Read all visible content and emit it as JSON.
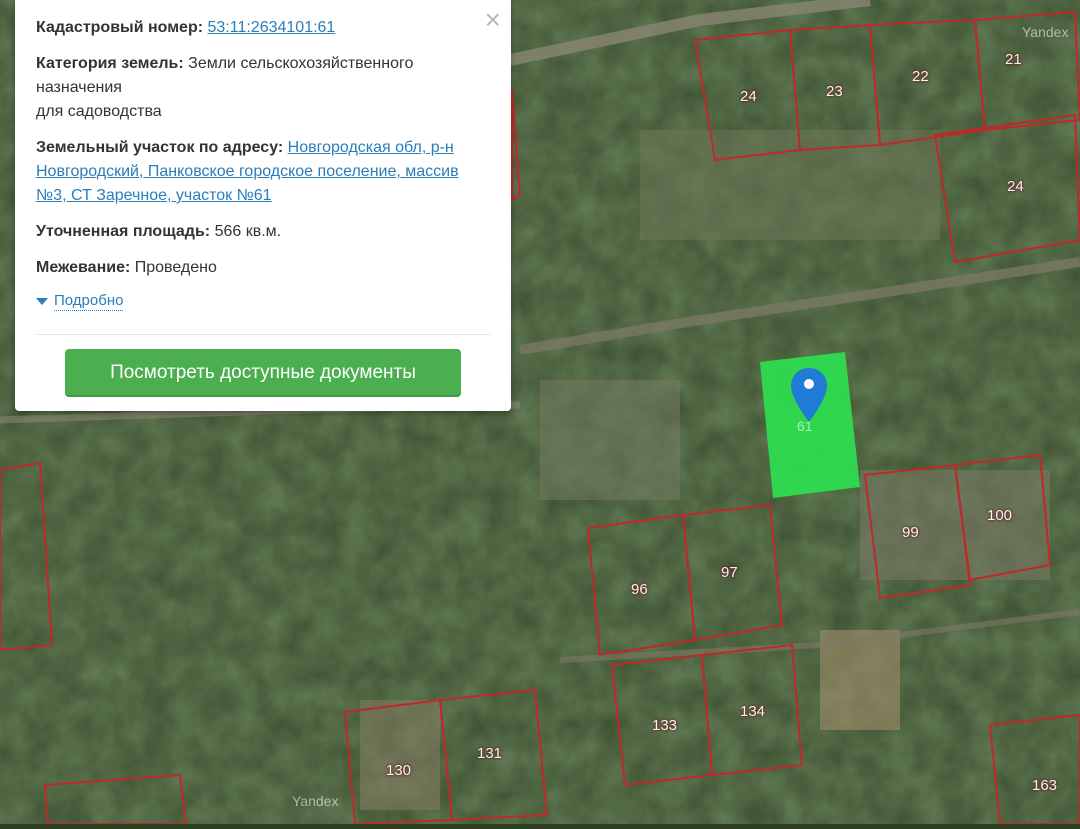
{
  "card": {
    "cadastral_label": "Кадастровый номер:",
    "cadastral_value": "53:11:2634101:61",
    "category_label": "Категория земель:",
    "category_value": "Земли сельскохозяйственного назначения",
    "category_use": "для садоводства",
    "address_label": "Земельный участок по адресу:",
    "address_value": "Новгородская обл, р-н Новгородский, Панковское городское поселение, массив №3, СТ Заречное, участок №61",
    "area_label": "Уточненная площадь:",
    "area_value": "566 кв.м.",
    "survey_label": "Межевание:",
    "survey_value": "Проведено",
    "more_label": "Подробно",
    "close_glyph": "×",
    "button_label": "Посмотреть доступные документы"
  },
  "map": {
    "watermark": "Yandex",
    "selected_plot_label": "61",
    "plot_labels": [
      "24",
      "23",
      "22",
      "21",
      "24",
      "99",
      "100",
      "96",
      "97",
      "133",
      "134",
      "130",
      "131",
      "163"
    ],
    "colors": {
      "boundary": "#c0282a",
      "selected_fill": "#2ee04e",
      "pin": "#1f7bd6",
      "button": "#4bae4f",
      "link": "#2a7db8"
    }
  }
}
